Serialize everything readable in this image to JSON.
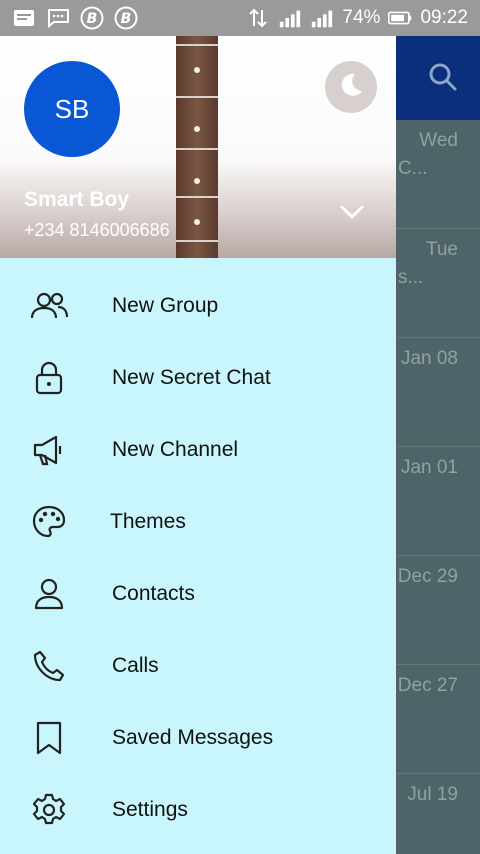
{
  "status_bar": {
    "battery": "74%",
    "time": "09:22"
  },
  "drawer": {
    "avatar_initials": "SB",
    "user_name": "Smart Boy",
    "user_phone": "+234 8146006686",
    "menu": [
      {
        "label": "New Group",
        "icon": "group-icon"
      },
      {
        "label": "New Secret Chat",
        "icon": "lock-icon"
      },
      {
        "label": "New Channel",
        "icon": "megaphone-icon"
      },
      {
        "label": "Themes",
        "icon": "palette-icon"
      },
      {
        "label": "Contacts",
        "icon": "person-icon"
      },
      {
        "label": "Calls",
        "icon": "phone-icon"
      },
      {
        "label": "Saved Messages",
        "icon": "bookmark-icon"
      },
      {
        "label": "Settings",
        "icon": "gear-icon"
      }
    ]
  },
  "chat_list": {
    "rows": [
      {
        "date": "Wed",
        "snippet": "C..."
      },
      {
        "date": "Tue",
        "snippet": "s..."
      },
      {
        "date": "Jan 08",
        "snippet": ""
      },
      {
        "date": "Jan 01",
        "snippet": ""
      },
      {
        "date": "Dec 29",
        "snippet": ""
      },
      {
        "date": "Dec 27",
        "snippet": ""
      },
      {
        "date": "Jul 19",
        "snippet": ""
      }
    ]
  },
  "colors": {
    "drawer_bg": "#c8f6fc",
    "avatar": "#0a57d6",
    "header_bar": "#0b2f7a"
  }
}
